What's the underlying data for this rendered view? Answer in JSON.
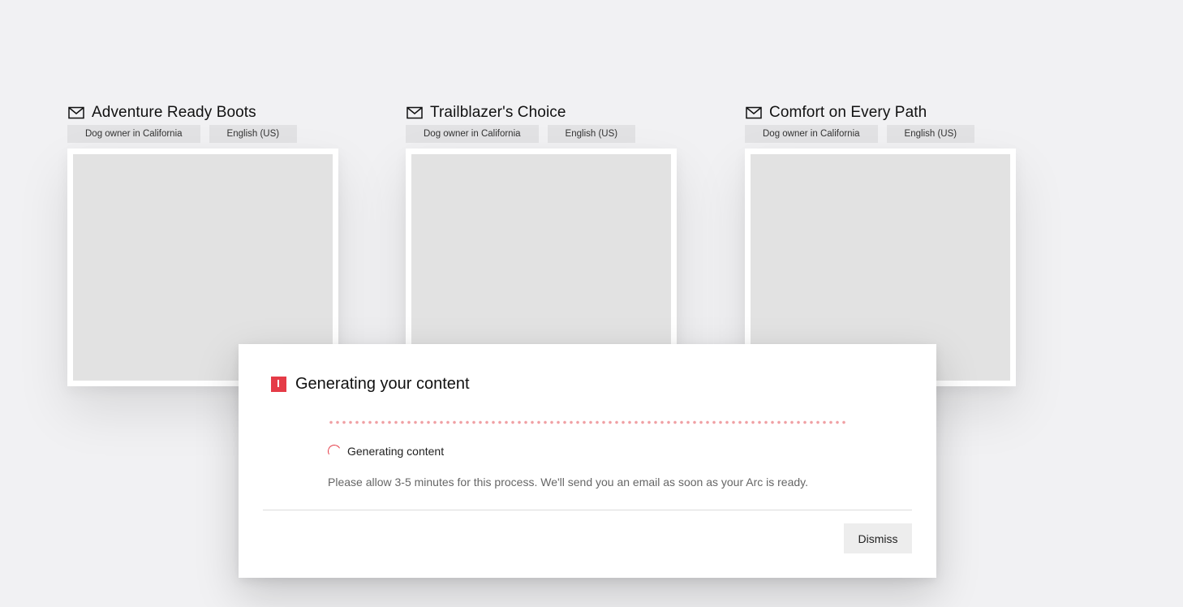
{
  "cards": [
    {
      "title": "Adventure Ready Boots",
      "icon": "mail-icon",
      "tags": [
        "Dog owner in California",
        "English (US)"
      ]
    },
    {
      "title": "Trailblazer's Choice",
      "icon": "mail-icon",
      "tags": [
        "Dog owner in California",
        "English (US)"
      ]
    },
    {
      "title": "Comfort on Every Path",
      "icon": "mail-icon",
      "tags": [
        "Dog owner in California",
        "English (US)"
      ]
    }
  ],
  "modal": {
    "icon": "alert-icon",
    "title": "Generating your content",
    "status": "Generating content",
    "note": "Please allow 3-5 minutes for this process. We'll send you an email as soon as your Arc is ready.",
    "dismiss_label": "Dismiss"
  },
  "colors": {
    "background": "#f1f1f3",
    "accent": "#e53b47",
    "progress_dots": "#f0a0a4",
    "placeholder": "#e2e2e2",
    "tag": "#e2e2e4",
    "button": "#ededed"
  }
}
